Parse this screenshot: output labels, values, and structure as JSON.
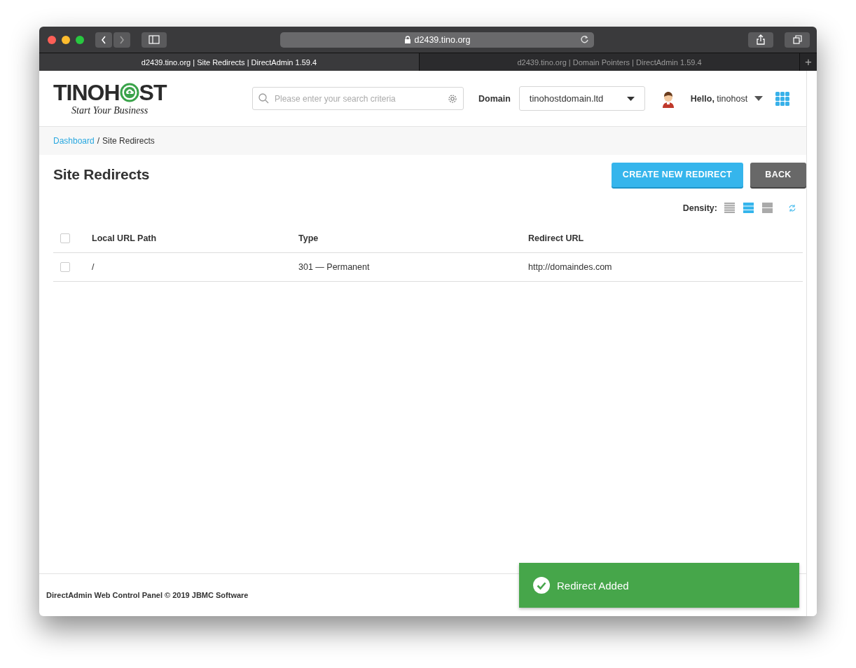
{
  "browser": {
    "url": "d2439.tino.org",
    "new_tab": "+",
    "tabs": [
      {
        "label": "d2439.tino.org | Site Redirects | DirectAdmin 1.59.4",
        "selected": true
      },
      {
        "label": "d2439.tino.org | Domain Pointers | DirectAdmin 1.59.4",
        "selected": false
      }
    ]
  },
  "header": {
    "logo": {
      "text_before_icon": "TINOH",
      "text_after_icon": "ST",
      "tagline": "Start Your Business"
    },
    "search": {
      "placeholder": "Please enter your search criteria"
    },
    "domain": {
      "label": "Domain",
      "value": "tinohostdomain.ltd"
    },
    "user": {
      "greeting": "**Hello,** tinohost"
    }
  },
  "breadcrumb": {
    "separator": "/",
    "items": [
      {
        "label": "Dashboard",
        "link": true
      },
      {
        "label": "Site Redirects",
        "link": false
      }
    ]
  },
  "page": {
    "title": "Site Redirects",
    "buttons": [
      {
        "label": "CREATE NEW REDIRECT",
        "kind": "primary"
      },
      {
        "label": "BACK",
        "kind": "secondary"
      }
    ],
    "density": {
      "label": "Density:",
      "options": [
        {
          "kind": "compact",
          "selected": false
        },
        {
          "kind": "normal",
          "selected": true
        },
        {
          "kind": "wide",
          "selected": false
        }
      ]
    }
  },
  "table": {
    "select_all": {
      "checked": false
    },
    "columns": [
      "Local URL Path",
      "Type",
      "Redirect URL"
    ],
    "rows": [
      {
        "checked": false,
        "cells": [
          "/",
          "301 — Permanent",
          "http://domaindes.com"
        ]
      }
    ]
  },
  "footer": {
    "text": "DirectAdmin Web Control Panel © 2019 JBMC Software"
  },
  "toast": {
    "message": "Redirect Added",
    "kind": "success"
  }
}
